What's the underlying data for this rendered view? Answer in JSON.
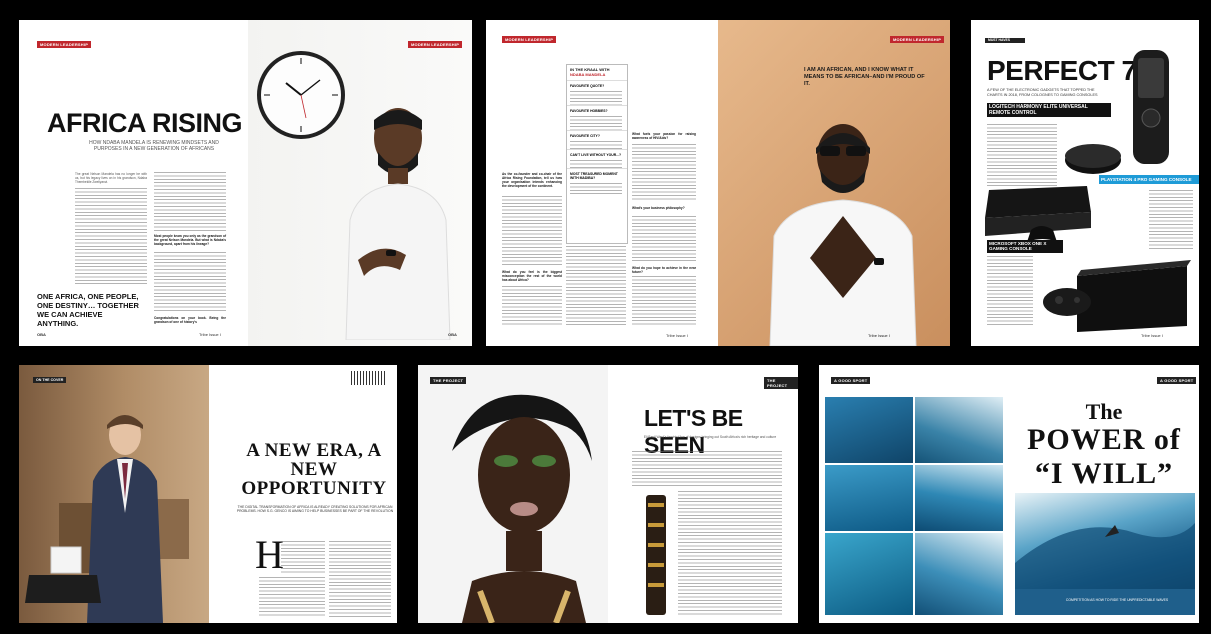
{
  "spread1": {
    "section": "MODERN LEADERSHIP",
    "headline": "AFRICA RISING",
    "standfirst": "HOW NDABA MANDELA IS RENEWING MINDSETS AND PURPOSES IN A NEW GENERATION OF AFRICANS",
    "pull_quote": "ONE AFRICA, ONE PEOPLE, ONE DESTINY… TOGETHER WE CAN ACHIEVE ANYTHING.",
    "body_snippet": "The great Nelson Mandela has no longer be with us, but his legacy lives on in his grandson, Ndaba Thembekile Zweliyanzi.",
    "qa_1": "Most people know you only as the grandson of the great Nelson Mandela. But what is Ndaba's background, apart from his lineage?",
    "qa_2": "Congratulations on your book. Being the grandson of one of history's",
    "folio_left": "OBA",
    "folio_right": "OBA",
    "issue": "Tribe Issue I"
  },
  "spread2": {
    "section": "MODERN LEADERSHIP",
    "sidebar_title": "IN THE KRAAL WITH",
    "sidebar_name": "NDABA MANDELA",
    "sidebar_items": [
      "FAVOURITE QUOTE?",
      "FAVOURITE HOBBIES?",
      "FAVOURITE CITY?",
      "CAN'T LIVE WITHOUT YOUR...?",
      "MOST TREASURED MOMENT WITH MADIBA?"
    ],
    "quote": "I AM AN AFRICAN, AND I KNOW WHAT IT MEANS TO BE AFRICAN–AND I'M PROUD OF IT.",
    "q1": "As the co-founder and co-chair of the Africa Rising Foundation, tell us how your organisation intends enhancing the development of the continent.",
    "q2": "What do you feel is the biggest misconception the rest of the world has about Africa?",
    "q3": "What fuels your passion for raising awareness of HIV/Aids?",
    "q4": "What's your business philosophy?",
    "q5": "What do you hope to achieve in the near future?",
    "issue": "Tribe Issue I"
  },
  "spread3": {
    "section": "MUST HAVES",
    "headline": "PERFECT 7",
    "standfirst": "A FEW OF THE ELECTRONIC GADGETS THAT TOPPED THE CHARTS IN 2018, FROM COLOGNES TO GAMING CONSOLES",
    "item1": "LOGITECH HARMONY ELITE UNIVERSAL REMOTE CONTROL",
    "item2": "PLAYSTATION 4 PRO GAMING CONSOLE",
    "item3": "MICROSOFT XBOX ONE X GAMING CONSOLE",
    "issue": "Tribe Issue I"
  },
  "spread4": {
    "section": "ON THE COVER",
    "headline": "A NEW ERA, A NEW OPPORTUNITY",
    "standfirst": "THE DIGITAL TRANSFORMATION OF AFRICA IS ALREADY CREATING SOLUTIONS FOR AFRICAN PROBLEMS. HOW S.G. GENCO IS AIMING TO HELP BUSINESSES BE PART OF THE REVOLUTION",
    "dropcap": "H"
  },
  "spread5": {
    "section": "THE PROJECT",
    "headline": "LET'S BE SEEN",
    "standfirst": "Eli Basil Ward's feminist line of designs bringing out South Africa's rich heritage and culture"
  },
  "spread6": {
    "section": "A GOOD SPORT",
    "headline_1": "The",
    "headline_2": "POWER of",
    "headline_3": "“I WILL”",
    "caption": "COMPETITION AS HOW TO RIDE THE UNPREDICTABLE WAVES"
  },
  "colors": {
    "accent_red": "#c0272d",
    "playstation_blue": "#1e9bd7",
    "wood": "#d9a97a",
    "ocean": "#1f5f8b"
  }
}
